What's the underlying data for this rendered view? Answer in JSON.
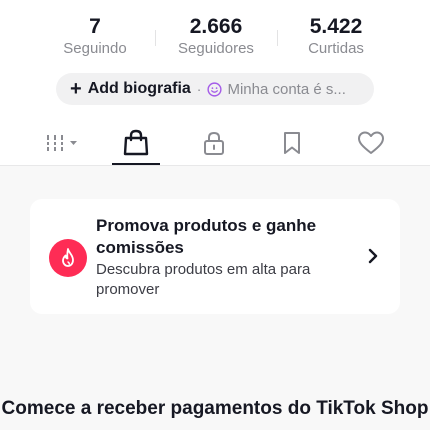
{
  "stats": [
    {
      "value": "7",
      "label": "Seguindo"
    },
    {
      "value": "2.666",
      "label": "Seguidores"
    },
    {
      "value": "5.422",
      "label": "Curtidas"
    }
  ],
  "bio": {
    "plus": "+",
    "add_label": "Add biografia",
    "separator": "·",
    "account_label": "Minha conta é s...",
    "icon": "smile-icon"
  },
  "tabs": [
    {
      "icon": "grid-icon",
      "selected": false
    },
    {
      "icon": "shopping-bag-icon",
      "selected": true
    },
    {
      "icon": "lock-icon",
      "selected": false
    },
    {
      "icon": "bookmark-icon",
      "selected": false
    },
    {
      "icon": "heart-icon",
      "selected": false
    }
  ],
  "promo": {
    "icon": "flame-icon",
    "title": "Promova produtos e ganhe comissões",
    "description": "Descubra produtos em alta para promover",
    "chevron": "chevron-right-icon",
    "icon_color": "#fe2c55"
  },
  "earn": {
    "title": "Comece a receber pagamentos do TikTok Shop"
  },
  "colors": {
    "text_primary": "#161823",
    "text_secondary": "#8a8b91",
    "accent": "#fe2c55",
    "smile_icon": "#a45be8"
  }
}
